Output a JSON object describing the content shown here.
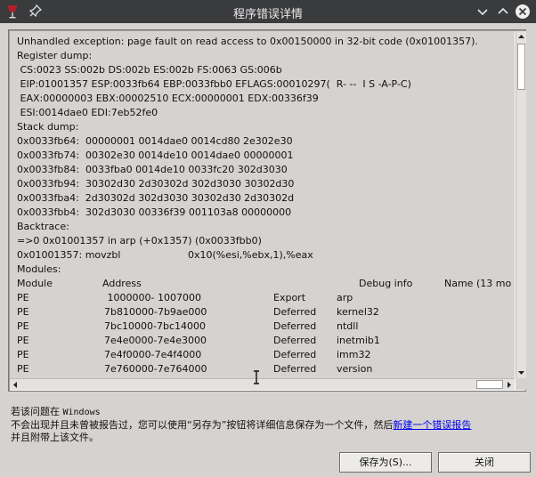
{
  "window": {
    "title": "程序错误详情",
    "accent_color": "#3a3b3d"
  },
  "report": {
    "lines": [
      "Unhandled exception: page fault on read access to 0x00150000 in 32-bit code (0x01001357).",
      "Register dump:",
      " CS:0023 SS:002b DS:002b ES:002b FS:0063 GS:006b",
      " EIP:01001357 ESP:0033fb64 EBP:0033fbb0 EFLAGS:00010297(  R- --  I S -A-P-C)",
      " EAX:00000003 EBX:00002510 ECX:00000001 EDX:00336f39",
      " ESI:0014dae0 EDI:7eb52fe0",
      "Stack dump:",
      "0x0033fb64:  00000001 0014dae0 0014cd80 2e302e30",
      "0x0033fb74:  00302e30 0014de10 0014dae0 00000001",
      "0x0033fb84:  0033fba0 0014de10 0033fc20 302d3030",
      "0x0033fb94:  30302d30 2d30302d 302d3030 30302d30",
      "0x0033fba4:  2d30302d 302d3030 30302d30 2d30302d",
      "0x0033fbb4:  302d3030 00336f39 001103a8 00000000",
      "Backtrace:",
      "=>0 0x01001357 in arp (+0x1357) (0x0033fbb0)"
    ],
    "disasm": {
      "addr": "0x01001357: movzbl",
      "operands": "0x10(%esi,%ebx,1),%eax"
    },
    "modules_label": "Modules:",
    "module_headers": [
      "Module",
      "Address",
      "Debug info",
      "Name (13 mo"
    ],
    "modules": [
      {
        "type": "PE",
        "address": " 1000000- 1007000",
        "debug": "Export",
        "name": "arp"
      },
      {
        "type": "PE",
        "address": "7b810000-7b9ae000",
        "debug": "Deferred",
        "name": "kernel32"
      },
      {
        "type": "PE",
        "address": "7bc10000-7bc14000",
        "debug": "Deferred",
        "name": "ntdll"
      },
      {
        "type": "PE",
        "address": "7e4e0000-7e4e3000",
        "debug": "Deferred",
        "name": "inetmib1"
      },
      {
        "type": "PE",
        "address": "7e4f0000-7e4f4000",
        "debug": "Deferred",
        "name": "imm32"
      },
      {
        "type": "PE",
        "address": "7e760000-7e764000",
        "debug": "Deferred",
        "name": "version"
      }
    ]
  },
  "info": {
    "line1_prefix": "若该问题在",
    "line1_app": "Windows",
    "line2": "不会出现并且未曾被报告过，您可以使用“另存为”按钮将详细信息保存为一个文件，然后",
    "link": "新建一个错误报告",
    "line3": "并且附带上该文件。"
  },
  "buttons": {
    "save": "保存为(S)...",
    "close": "关闭"
  }
}
